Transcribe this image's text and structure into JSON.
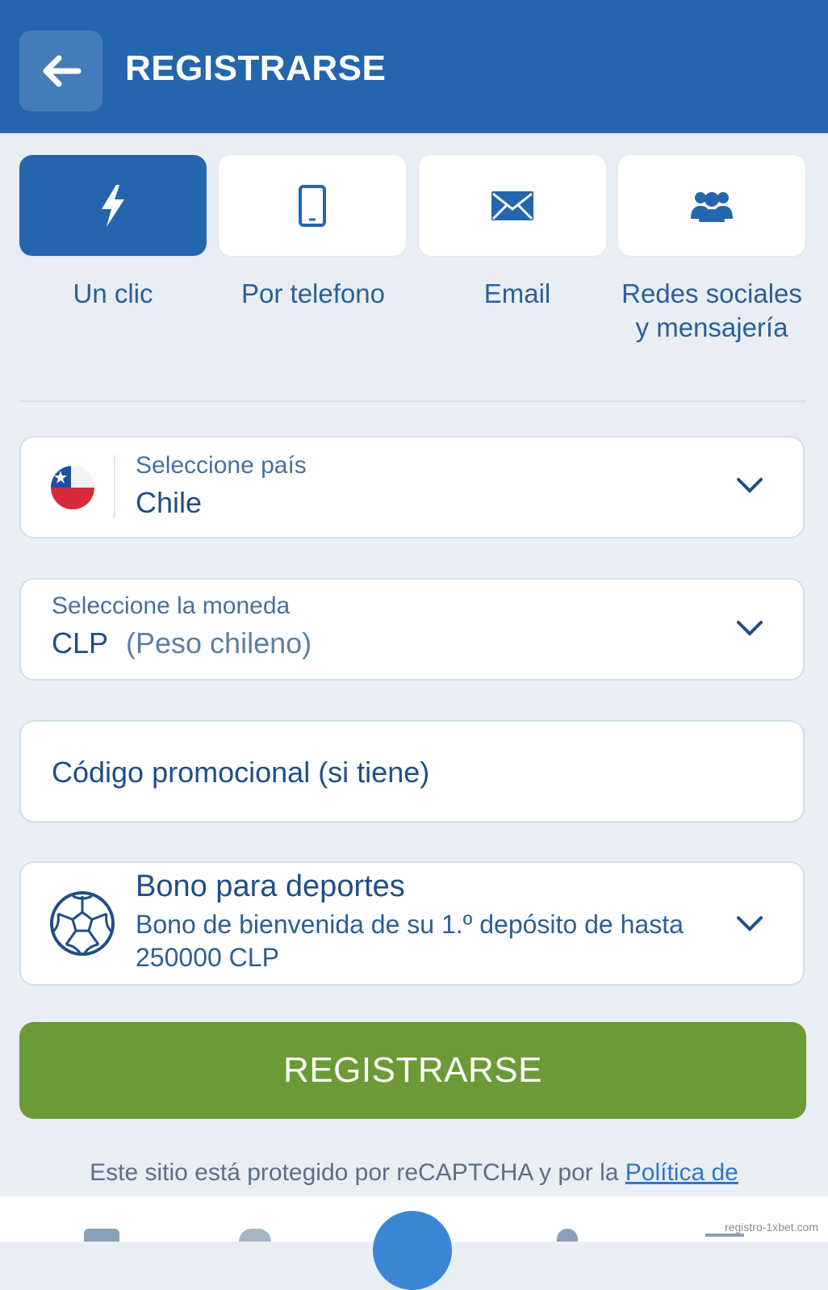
{
  "header": {
    "title": "REGISTRARSE",
    "back_icon": "arrow-left-icon"
  },
  "tabs": [
    {
      "label": "Un clic",
      "icon": "lightning-icon",
      "active": true
    },
    {
      "label": "Por telefono",
      "icon": "phone-icon",
      "active": false
    },
    {
      "label": "Email",
      "icon": "envelope-icon",
      "active": false
    },
    {
      "label": "Redes sociales y mensajería",
      "icon": "people-icon",
      "active": false
    }
  ],
  "country": {
    "label": "Seleccione país",
    "value": "Chile",
    "flag": "chile-flag-icon"
  },
  "currency": {
    "label": "Seleccione la moneda",
    "code": "CLP",
    "name": "(Peso chileno)"
  },
  "promo": {
    "placeholder": "Código promocional (si tiene)"
  },
  "bonus": {
    "title": "Bono para deportes",
    "description": "Bono de bienvenida de su 1.º depósito de hasta 250000 CLP",
    "icon": "soccer-ball-icon"
  },
  "register_button": {
    "label": "REGISTRARSE"
  },
  "footer": {
    "text": "Este sitio está protegido por reCAPTCHA y por la",
    "link": "Política de"
  },
  "watermark": "registro-1xbet.com",
  "colors": {
    "header": "#2466ad",
    "accent_green": "#6b9a37",
    "text_blue": "#1e4f86"
  }
}
